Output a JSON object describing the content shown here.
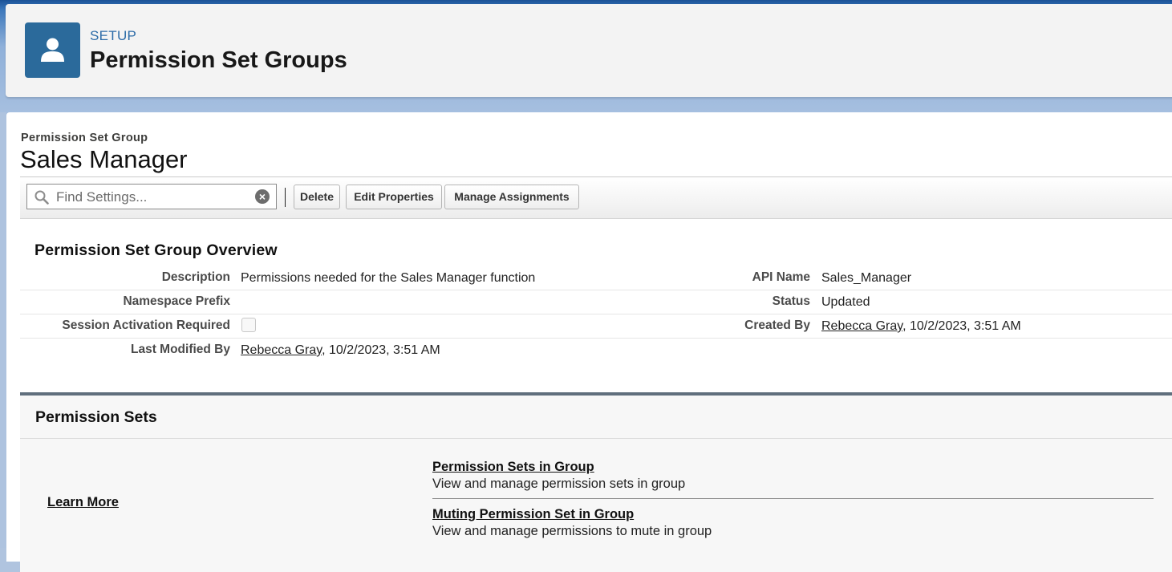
{
  "setup_header": {
    "label": "SETUP",
    "title": "Permission Set Groups",
    "icon": "user-icon"
  },
  "record": {
    "type": "Permission Set Group",
    "name": "Sales Manager"
  },
  "toolbar": {
    "search_placeholder": "Find Settings...",
    "delete_label": "Delete",
    "edit_label": "Edit Properties",
    "manage_label": "Manage Assignments"
  },
  "overview": {
    "title": "Permission Set Group Overview",
    "description_label": "Description",
    "description_value": "Permissions needed for the Sales Manager function",
    "api_name_label": "API Name",
    "api_name_value": "Sales_Manager",
    "namespace_label": "Namespace Prefix",
    "status_label": "Status",
    "status_value": "Updated",
    "session_label": "Session Activation Required",
    "session_checked": false,
    "created_label": "Created By",
    "created_user": "Rebecca Gray",
    "created_date": ", 10/2/2023, 3:51 AM",
    "modified_label": "Last Modified By",
    "modified_user": "Rebecca Gray",
    "modified_date": ", 10/2/2023, 3:51 AM"
  },
  "permission_sets": {
    "title": "Permission Sets",
    "learn_more": "Learn More",
    "links": [
      {
        "label": "Permission Sets in Group",
        "description": "View and manage permission sets in group"
      },
      {
        "label": "Muting Permission Set in Group",
        "description": "View and manage permissions to mute in group"
      }
    ]
  },
  "colors": {
    "header_icon_bg": "#2b6a9b",
    "setup_label": "#2d6ca8",
    "panel_border": "#606f7d"
  }
}
